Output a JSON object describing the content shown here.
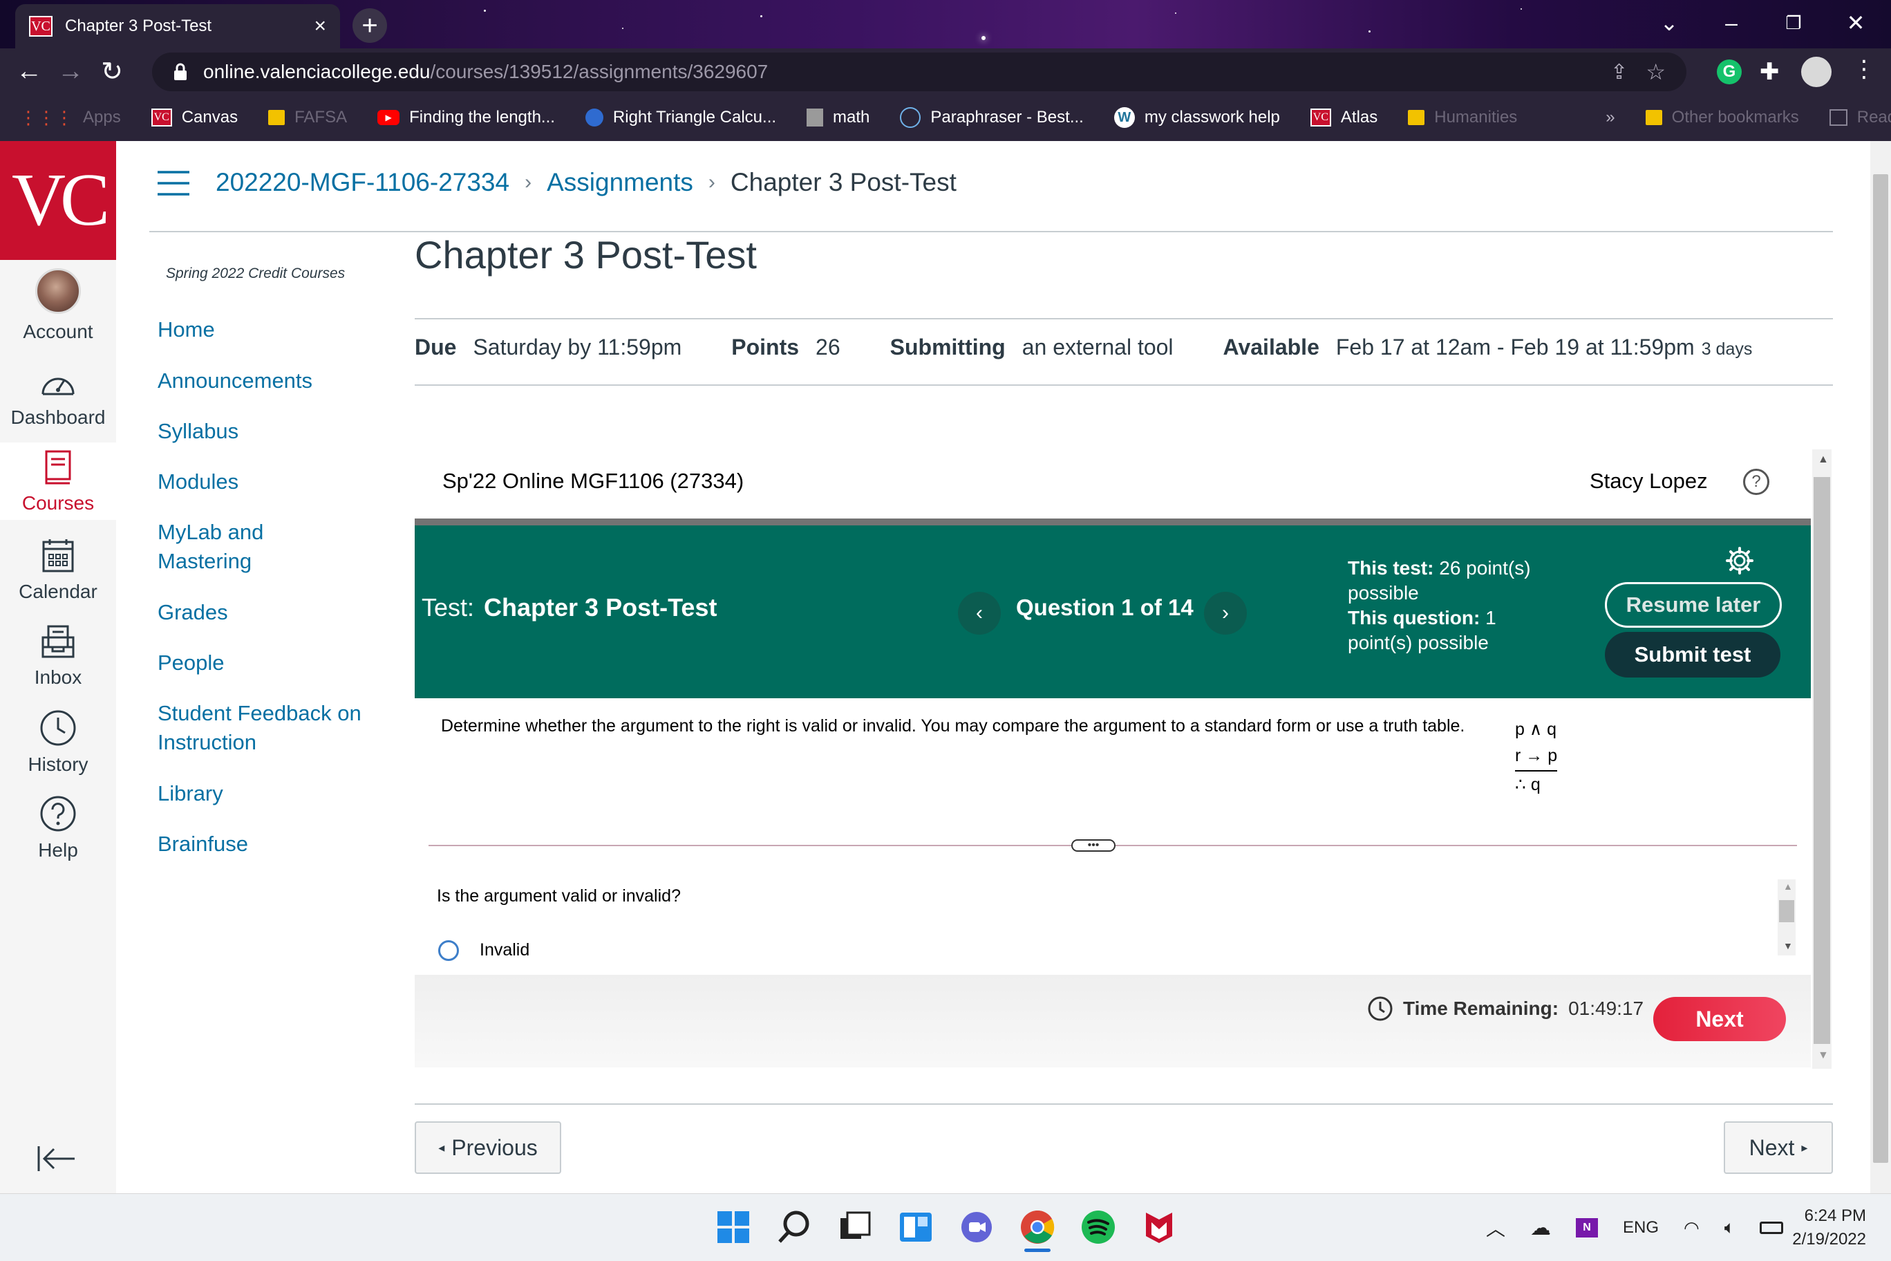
{
  "browser": {
    "tab_title": "Chapter 3 Post-Test",
    "favicon_text": "VC",
    "url_host": "online.valenciacollege.edu",
    "url_path": "/courses/139512/assignments/3629607",
    "bookmarks": [
      {
        "label": "Apps",
        "dim": true
      },
      {
        "label": "Canvas"
      },
      {
        "label": "FAFSA",
        "dim": true
      },
      {
        "label": "Finding the length..."
      },
      {
        "label": "Right Triangle Calcu..."
      },
      {
        "label": "math"
      },
      {
        "label": "Paraphraser - Best..."
      },
      {
        "label": "my classwork help"
      },
      {
        "label": "Atlas"
      },
      {
        "label": "Humanities",
        "dim": true
      }
    ],
    "more_bookmarks": "»",
    "other_bookmarks": "Other bookmarks",
    "reading_list": "Reading list"
  },
  "global_nav": {
    "logo": "VC",
    "items": [
      {
        "label": "Account",
        "icon": "avatar"
      },
      {
        "label": "Dashboard",
        "icon": "dashboard-icon"
      },
      {
        "label": "Courses",
        "icon": "courses-icon",
        "active": true
      },
      {
        "label": "Calendar",
        "icon": "calendar-icon"
      },
      {
        "label": "Inbox",
        "icon": "inbox-icon"
      },
      {
        "label": "History",
        "icon": "history-icon"
      },
      {
        "label": "Help",
        "icon": "help-icon"
      }
    ]
  },
  "breadcrumb": {
    "course": "202220-MGF-1106-27334",
    "section": "Assignments",
    "current": "Chapter 3 Post-Test",
    "separator": "›"
  },
  "course_nav": {
    "term": "Spring 2022 Credit Courses",
    "items": [
      "Home",
      "Announcements",
      "Syllabus",
      "Modules",
      "MyLab and Mastering",
      "Grades",
      "People",
      "Student Feedback on Instruction",
      "Library",
      "Brainfuse"
    ]
  },
  "assignment": {
    "title": "Chapter 3 Post-Test",
    "due_label": "Due",
    "due_value": "Saturday by 11:59pm",
    "points_label": "Points",
    "points_value": "26",
    "submitting_label": "Submitting",
    "submitting_value": "an external tool",
    "available_label": "Available",
    "available_value": "Feb 17 at 12am - Feb 19 at 11:59pm",
    "available_duration": "3 days"
  },
  "tool": {
    "course_label": "Sp'22 Online MGF1106 (27334)",
    "user_name": "Stacy Lopez",
    "help_glyph": "?",
    "test_prefix": "Test:",
    "test_name": "Chapter 3 Post-Test",
    "question_position": "Question 1 of 14",
    "prev_arrow": "‹",
    "next_arrow": "›",
    "this_test_label": "This test:",
    "this_test_value": "26 point(s) possible",
    "this_question_label": "This question:",
    "this_question_value": "1 point(s) possible",
    "resume_label": "Resume later",
    "submit_label": "Submit test",
    "question_text": "Determine whether the argument to the right is valid or invalid. You may compare the argument to a standard form or use a truth table.",
    "argument_lines": [
      "p ∧ q",
      "r → p",
      "∴ q"
    ],
    "expand_glyph": "•••",
    "sub_question": "Is the argument valid or invalid?",
    "option_invalid": "Invalid",
    "time_label": "Time Remaining:",
    "time_value": "01:49:17",
    "next_label": "Next"
  },
  "pager": {
    "previous_label": "Previous",
    "next_label": "Next"
  },
  "taskbar": {
    "language": "ENG",
    "time": "6:24 PM",
    "date": "2/19/2022"
  },
  "colors": {
    "canvas_red": "#c8102e",
    "link_blue": "#0770a3",
    "test_bar_green": "#006c5d",
    "submit_navy": "#10343a",
    "next_red": "#e3213b"
  }
}
